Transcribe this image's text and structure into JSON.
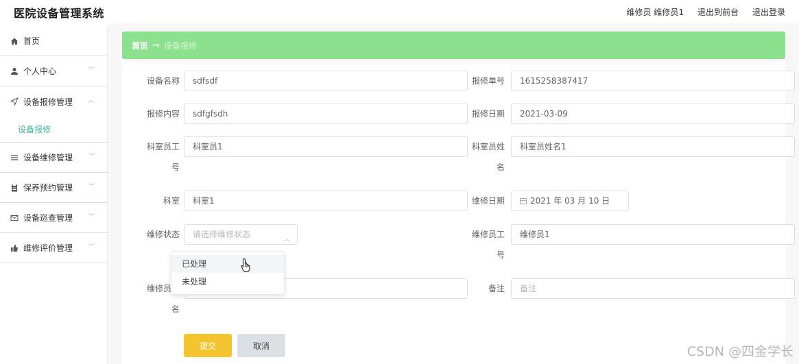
{
  "app": {
    "title": "医院设备管理系统",
    "user_label": "维修员 维修员1",
    "link_front": "退出到前台",
    "link_logout": "退出登录"
  },
  "sidebar": {
    "items": [
      {
        "label": "首页",
        "icon": "home-icon"
      },
      {
        "label": "个人中心",
        "icon": "user-icon"
      },
      {
        "label": "设备报修管理",
        "icon": "send-icon"
      },
      {
        "label": "设备维修管理",
        "icon": "list-icon"
      },
      {
        "label": "保养预约管理",
        "icon": "clipboard-icon"
      },
      {
        "label": "设备巡查管理",
        "icon": "mail-icon"
      },
      {
        "label": "维修评价管理",
        "icon": "thumb-icon"
      }
    ],
    "sub_items": [
      {
        "label": "设备报修"
      }
    ]
  },
  "breadcrumb": {
    "home": "首页",
    "arrow": "→",
    "current": "设备报修"
  },
  "form": {
    "device_name": {
      "label": "设备名称",
      "value": "sdfsdf"
    },
    "repair_no": {
      "label": "报修单号",
      "value": "1615258387417"
    },
    "repair_content": {
      "label": "报修内容",
      "value": "sdfgfsdh"
    },
    "repair_date": {
      "label": "报修日期",
      "value": "2021-03-09"
    },
    "staff_no": {
      "label_a": "科室员工",
      "label_b": "号",
      "value": "科室员1"
    },
    "staff_name": {
      "label_a": "科室员姓",
      "label_b": "名",
      "value": "科室员姓名1"
    },
    "department": {
      "label": "科室",
      "value": "科室1"
    },
    "maintenance_date": {
      "label": "维修日期",
      "value": "2021 年 03 月 10 日"
    },
    "repair_status": {
      "label": "维修状态",
      "placeholder": "请选择维修状态",
      "options": [
        "已处理",
        "未处理"
      ]
    },
    "repairer_no": {
      "label_a": "维修员工",
      "label_b": "号",
      "value": "维修员1"
    },
    "repairer_name": {
      "label_a": "维修员姓",
      "label_b": "名",
      "value": ""
    },
    "remark": {
      "label": "备注",
      "placeholder": "备注"
    }
  },
  "buttons": {
    "submit": "提交",
    "cancel": "取消"
  },
  "watermark": "CSDN @四金学长",
  "colors": {
    "breadcrumb_bg": "#8ce08e",
    "active_sub": "#43b5a0",
    "submit_bg": "#f4c430",
    "cancel_bg": "#dcdfe4"
  }
}
